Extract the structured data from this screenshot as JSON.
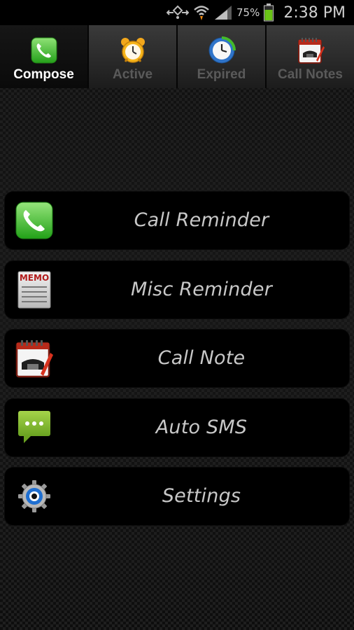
{
  "status_bar": {
    "battery_percent": "75%",
    "time": "2:38 PM",
    "icons": [
      "network-icon",
      "wifi-icon",
      "signal-icon",
      "battery-icon"
    ]
  },
  "tabs": [
    {
      "label": "Compose",
      "icon": "phone-icon",
      "active": true
    },
    {
      "label": "Active",
      "icon": "alarm-clock-icon",
      "active": false
    },
    {
      "label": "Expired",
      "icon": "history-clock-icon",
      "active": false
    },
    {
      "label": "Call Notes",
      "icon": "notepad-phone-icon",
      "active": false
    }
  ],
  "menu": {
    "items": [
      {
        "label": "Call Reminder",
        "icon": "phone-icon"
      },
      {
        "label": "Misc Reminder",
        "icon": "memo-icon",
        "icon_text": "MEMO"
      },
      {
        "label": "Call Note",
        "icon": "notepad-phone-icon"
      },
      {
        "label": "Auto SMS",
        "icon": "sms-bubble-icon"
      },
      {
        "label": "Settings",
        "icon": "gear-icon"
      }
    ]
  },
  "colors": {
    "accent_green": "#3fb62a",
    "battery_green": "#6ac417",
    "active_tab_text": "#ffffff",
    "inactive_tab_text": "#5a5a5a"
  }
}
